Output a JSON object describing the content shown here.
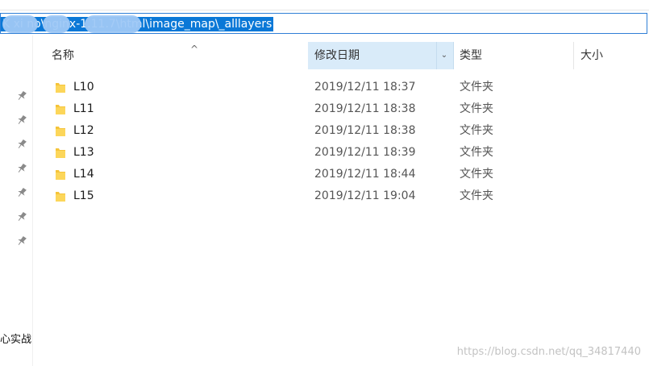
{
  "address": {
    "path": "K    xi      no\\nginx-1.11.7\\html\\image_map\\_alllayers"
  },
  "columns": {
    "name": "名称",
    "date": "修改日期",
    "type": "类型",
    "size": "大小"
  },
  "files": [
    {
      "name": "L10",
      "date": "2019/12/11 18:37",
      "type": "文件夹"
    },
    {
      "name": "L11",
      "date": "2019/12/11 18:38",
      "type": "文件夹"
    },
    {
      "name": "L12",
      "date": "2019/12/11 18:38",
      "type": "文件夹"
    },
    {
      "name": "L13",
      "date": "2019/12/11 18:39",
      "type": "文件夹"
    },
    {
      "name": "L14",
      "date": "2019/12/11 18:44",
      "type": "文件夹"
    },
    {
      "name": "L15",
      "date": "2019/12/11 19:04",
      "type": "文件夹"
    }
  ],
  "nav": {
    "label": "心实战"
  },
  "watermark": "https://blog.csdn.net/qq_34817440",
  "colors": {
    "selection": "#0a78d7",
    "header_active": "#d9ebf9",
    "folder": "#f5c43a"
  }
}
